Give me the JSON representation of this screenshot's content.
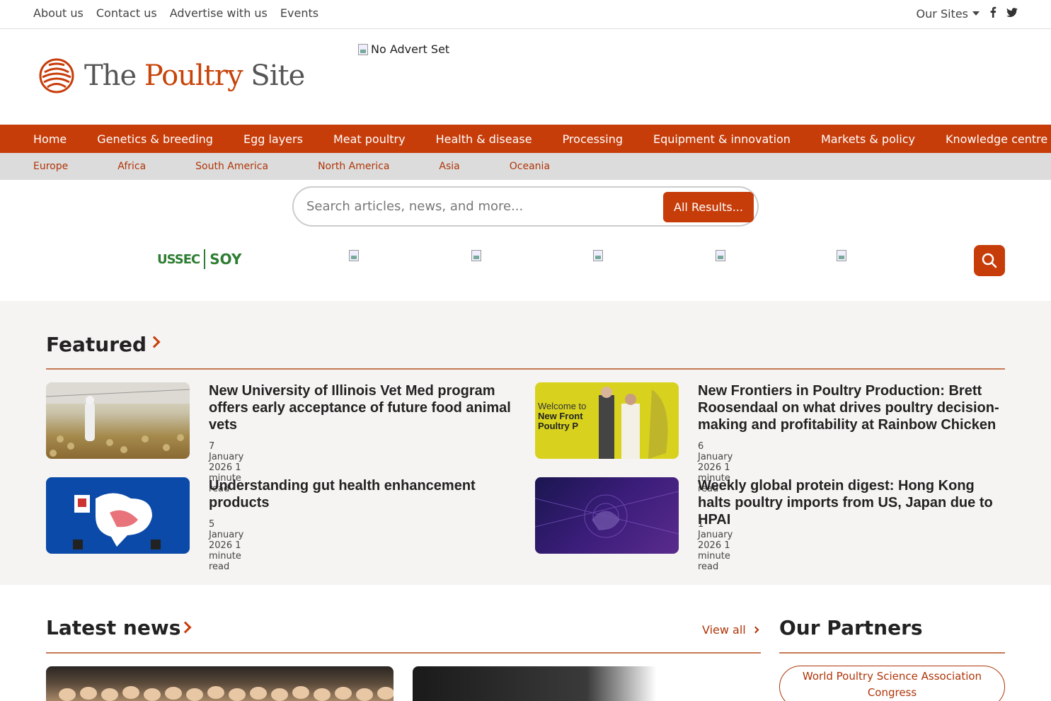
{
  "topbar": {
    "links": [
      "About us",
      "Contact us",
      "Advertise with us",
      "Events"
    ],
    "our_sites": "Our Sites"
  },
  "logo": {
    "text_the": "The",
    "text_poultry": "Poultry",
    "text_site": "Site"
  },
  "advert": {
    "alt": "No Advert Set"
  },
  "main_nav": [
    "Home",
    "Genetics & breeding",
    "Egg layers",
    "Meat poultry",
    "Health & disease",
    "Processing",
    "Equipment & innovation",
    "Markets & policy",
    "Knowledge centre"
  ],
  "sub_nav": [
    "Europe",
    "Africa",
    "South America",
    "North America",
    "Asia",
    "Oceania"
  ],
  "search": {
    "placeholder": "Search articles, news, and more...",
    "button": "All Results..."
  },
  "sponsor": {
    "ussec": "USSEC",
    "soy": "SOY"
  },
  "featured": {
    "title": "Featured",
    "articles": [
      {
        "title": "New University of Illinois Vet Med program offers early acceptance of future food animal vets",
        "meta": "7 January 2026 1 minute read"
      },
      {
        "title": "New Frontiers in Poultry Production: Brett Roosendaal on what drives poultry decision-making and profitability at Rainbow Chicken",
        "meta": "6 January 2026 1 minute read"
      },
      {
        "title": "Understanding gut health enhancement products",
        "meta": "5 January 2026 1 minute read"
      },
      {
        "title": "Weekly global protein digest: Hong Kong halts poultry imports from US, Japan due to HPAI",
        "meta": "1 January 2026 1 minute read"
      }
    ]
  },
  "latest": {
    "title": "Latest news",
    "view_all": "View all"
  },
  "partners": {
    "title": "Our Partners",
    "items": [
      "World Poultry Science Association Congress"
    ]
  },
  "colors": {
    "brand": "#c73d0a",
    "subnav_bg": "#dcdcdc",
    "featured_bg": "#f5f4f2"
  }
}
